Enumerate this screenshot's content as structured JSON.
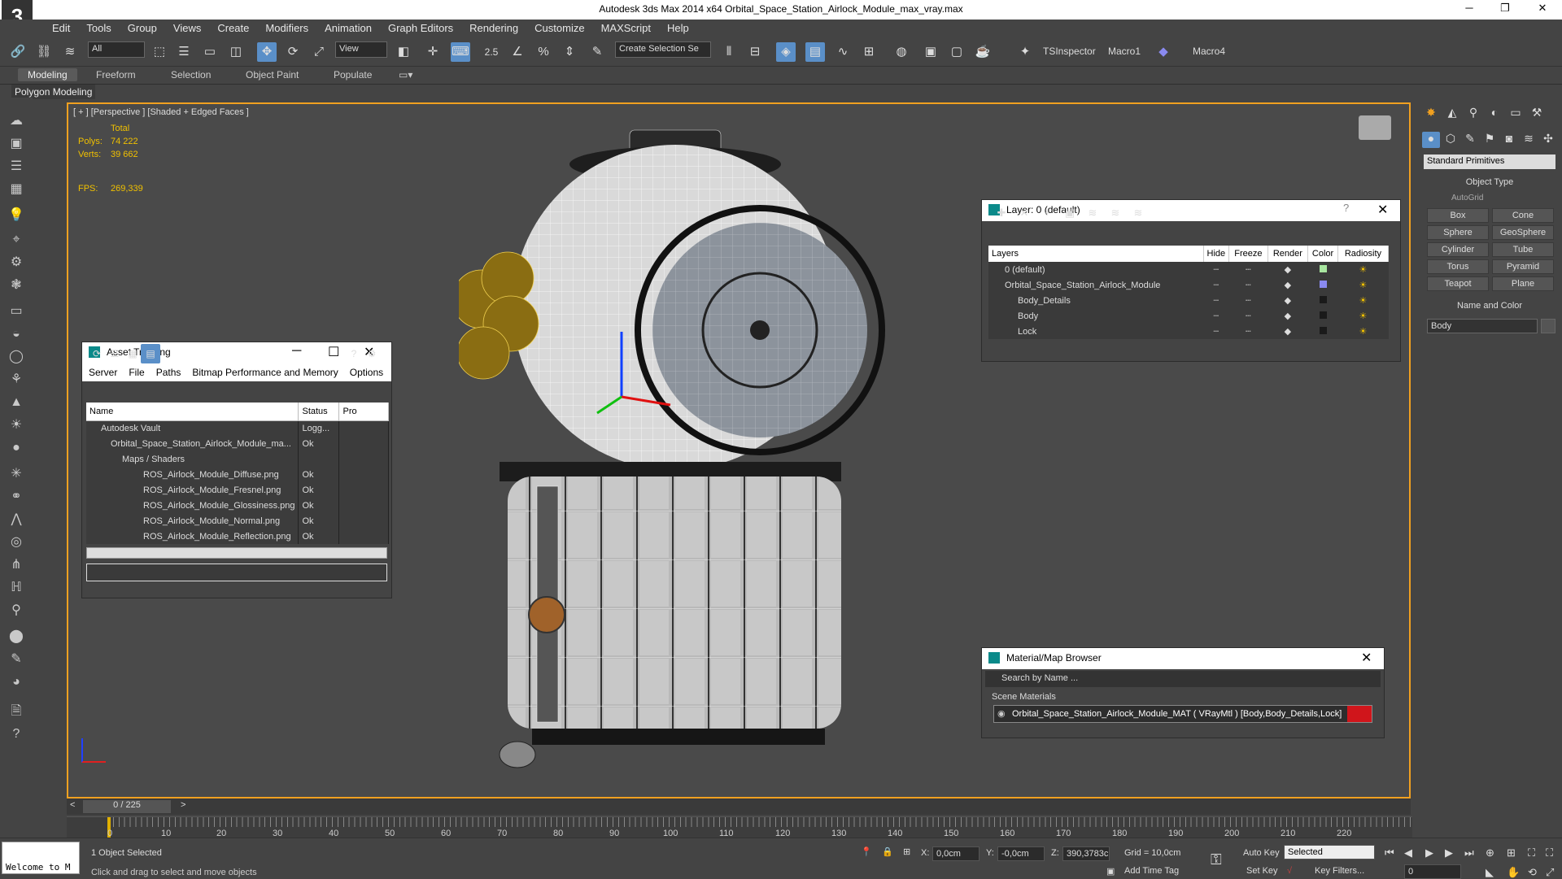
{
  "title_bar": {
    "app_title": "Autodesk 3ds Max  2014 x64     Orbital_Space_Station_Airlock_Module_max_vray.max",
    "logo": "3",
    "minimize": "─",
    "restore": "❐",
    "close": "✕"
  },
  "menu": [
    "Edit",
    "Tools",
    "Group",
    "Views",
    "Create",
    "Modifiers",
    "Animation",
    "Graph Editors",
    "Rendering",
    "Customize",
    "MAXScript",
    "Help"
  ],
  "toolbar": {
    "filter_select": "All",
    "view_select": "View",
    "spinner_snap": "2.5",
    "selection_set": "Create Selection Se",
    "macros": [
      "TSInspector",
      "Macro1",
      "Macro4"
    ]
  },
  "ribbon": {
    "tabs": [
      "Modeling",
      "Freeform",
      "Selection",
      "Object Paint",
      "Populate"
    ],
    "active": "Modeling",
    "panel": "Polygon Modeling"
  },
  "viewport": {
    "label": "[ + ] [Perspective ] [Shaded + Edged Faces ]",
    "stats": {
      "total_label": "Total",
      "polys_label": "Polys:",
      "polys": "74 222",
      "verts_label": "Verts:",
      "verts": "39 662",
      "fps_label": "FPS:",
      "fps": "269,339"
    }
  },
  "asset_tracking": {
    "title": "Asset Tracking",
    "menu": [
      "Server",
      "File",
      "Paths",
      "Bitmap Performance and Memory",
      "Options"
    ],
    "columns": [
      "Name",
      "Status",
      "Pro"
    ],
    "rows": [
      {
        "name": "Autodesk Vault",
        "status": "Logg..."
      },
      {
        "name": "Orbital_Space_Station_Airlock_Module_ma...",
        "status": "Ok"
      },
      {
        "name": "Maps / Shaders",
        "status": ""
      },
      {
        "name": "ROS_Airlock_Module_Diffuse.png",
        "status": "Ok"
      },
      {
        "name": "ROS_Airlock_Module_Fresnel.png",
        "status": "Ok"
      },
      {
        "name": "ROS_Airlock_Module_Glossiness.png",
        "status": "Ok"
      },
      {
        "name": "ROS_Airlock_Module_Normal.png",
        "status": "Ok"
      },
      {
        "name": "ROS_Airlock_Module_Reflection.png",
        "status": "Ok"
      }
    ]
  },
  "layer_dialog": {
    "title": "Layer: 0 (default)",
    "help": "?",
    "columns": [
      "Layers",
      "Hide",
      "Freeze",
      "Render",
      "Color",
      "Radiosity"
    ],
    "rows": [
      {
        "name": "0 (default)",
        "color": "#a8e6a0"
      },
      {
        "name": "Orbital_Space_Station_Airlock_Module",
        "color": "#8a8af0"
      },
      {
        "name": "Body_Details",
        "color": "#1a1a1a"
      },
      {
        "name": "Body",
        "color": "#1a1a1a"
      },
      {
        "name": "Lock",
        "color": "#1a1a1a"
      }
    ]
  },
  "material_browser": {
    "title": "Material/Map Browser",
    "search_placeholder": "Search by Name ...",
    "section": "Scene Materials",
    "material": "Orbital_Space_Station_Airlock_Module_MAT ( VRayMtl ) [Body,Body_Details,Lock]"
  },
  "command_panel": {
    "dropdown": "Standard Primitives",
    "object_type_header": "Object Type",
    "autogrid": "AutoGrid",
    "buttons": [
      "Box",
      "Cone",
      "Sphere",
      "GeoSphere",
      "Cylinder",
      "Tube",
      "Torus",
      "Pyramid",
      "Teapot",
      "Plane"
    ],
    "name_color_header": "Name and Color",
    "name_value": "Body"
  },
  "timeline": {
    "frame": "0 / 225",
    "ticks": [
      "0",
      "10",
      "20",
      "30",
      "40",
      "50",
      "60",
      "70",
      "80",
      "90",
      "100",
      "110",
      "120",
      "130",
      "140",
      "150",
      "160",
      "170",
      "180",
      "190",
      "200",
      "210",
      "220"
    ]
  },
  "status": {
    "welcome": "Welcome to M",
    "selected": "1 Object Selected",
    "prompt": "Click and drag to select and move objects",
    "x_label": "X:",
    "x": "0,0cm",
    "y_label": "Y:",
    "y": "-0,0cm",
    "z_label": "Z:",
    "z": "390,3783c",
    "grid": "Grid = 10,0cm",
    "add_time_tag": "Add Time Tag",
    "auto_key": "Auto Key",
    "set_key": "Set Key",
    "key_mode": "Selected",
    "key_filters": "Key Filters...",
    "frame_field": "0"
  }
}
